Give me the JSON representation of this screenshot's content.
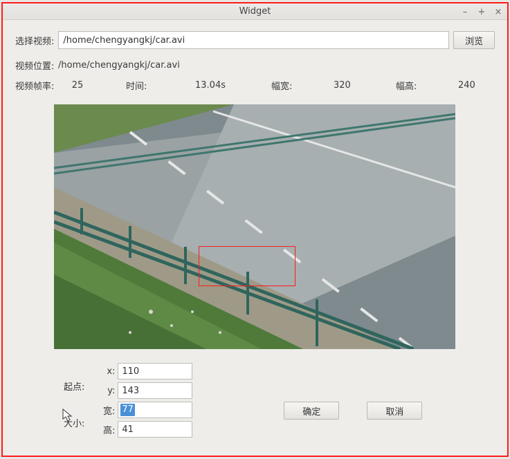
{
  "window": {
    "title": "Widget"
  },
  "select_video": {
    "label": "选择视频:",
    "path": "/home/chengyangkj/car.avi",
    "browse_label": "浏览"
  },
  "video_loc": {
    "label": "视频位置:",
    "path": "/home/chengyangkj/car.avi"
  },
  "metrics": {
    "fps_label": "视频帧率:",
    "fps_value": "25",
    "time_label": "时间:",
    "time_value": "13.04s",
    "width_label": "幅宽:",
    "width_value": "320",
    "height_label": "幅高:",
    "height_value": "240"
  },
  "roi": {
    "start_label": "起点:",
    "size_label": "大小:",
    "x_label": "x:",
    "y_label": "y:",
    "w_label": "宽:",
    "h_label": "高:",
    "x": "110",
    "y": "143",
    "w": "77",
    "h": "41"
  },
  "buttons": {
    "ok": "确定",
    "cancel": "取消"
  },
  "winctrl": {
    "minimize": "–",
    "maximize": "+",
    "close": "×"
  }
}
